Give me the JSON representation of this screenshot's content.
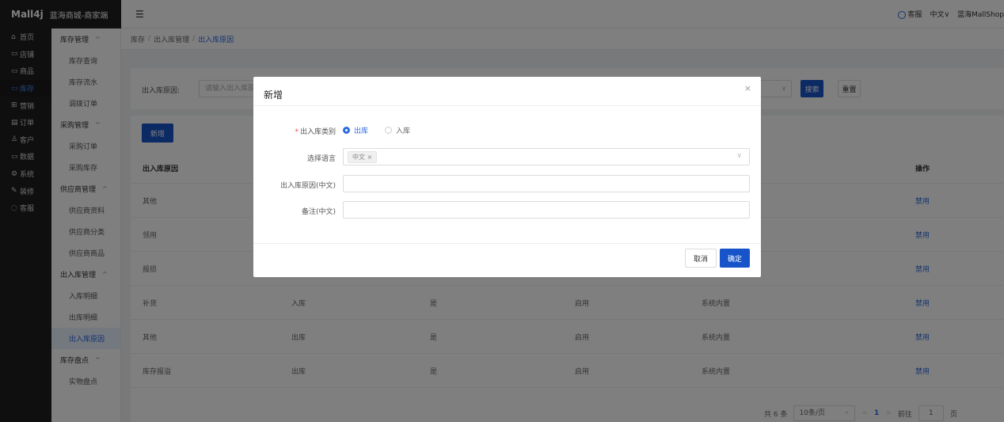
{
  "topbar": {
    "brand": "Mall4j",
    "shop_name": "蓝海商城-商家端",
    "hamburger": "☰",
    "service_label": "客服",
    "language": "中文∨",
    "user": "蓝海MallShop"
  },
  "leftnav": [
    {
      "icon": "⌂",
      "label": "首页"
    },
    {
      "icon": "▭",
      "label": "店铺"
    },
    {
      "icon": "▭",
      "label": "商品"
    },
    {
      "icon": "▭",
      "label": "库存"
    },
    {
      "icon": "⊞",
      "label": "营销"
    },
    {
      "icon": "▤",
      "label": "订单"
    },
    {
      "icon": "♙",
      "label": "客户"
    },
    {
      "icon": "▭",
      "label": "数据"
    },
    {
      "icon": "⚙",
      "label": "系统"
    },
    {
      "icon": "✎",
      "label": "装修"
    },
    {
      "icon": "◌",
      "label": "客服"
    }
  ],
  "subnav": {
    "g1": "库存管理",
    "g1a": "库存查询",
    "g1b": "库存流水",
    "g1c": "调拨订单",
    "g2": "采购管理",
    "g2a": "采购订单",
    "g2b": "采购库存",
    "g3": "供应商管理",
    "g3a": "供应商资料",
    "g3b": "供应商分类",
    "g3c": "供应商商品",
    "g4": "出入库管理",
    "g4a": "入库明细",
    "g4b": "出库明细",
    "g4c": "出入库原因",
    "g5": "库存盘点",
    "g5a": "实物盘点",
    "arrow": "^"
  },
  "breadcrumb": {
    "a": "库存",
    "b": "出入库管理",
    "c": "出入库原因",
    "sep": "/"
  },
  "search": {
    "label": "出入库原因:",
    "placeholder": "请输入出入库原因",
    "select_chev": "∨",
    "search_label": "搜索",
    "reset_label": "重置"
  },
  "table": {
    "add_label": "新增",
    "headers": [
      "出入库原因",
      "",
      "",
      "",
      "",
      "操作"
    ],
    "rows": [
      [
        "其他",
        "",
        "",
        "",
        "",
        "禁用"
      ],
      [
        "领用",
        "",
        "",
        "",
        "",
        "禁用"
      ],
      [
        "报损",
        "",
        "",
        "",
        "",
        "禁用"
      ],
      [
        "补货",
        "入库",
        "是",
        "启用",
        "系统内置",
        "禁用"
      ],
      [
        "其他",
        "出库",
        "是",
        "启用",
        "系统内置",
        "禁用"
      ],
      [
        "库存报溢",
        "出库",
        "是",
        "启用",
        "系统内置",
        "禁用"
      ]
    ]
  },
  "pager": {
    "total": "共 6 条",
    "size": "10条/页",
    "prev": "<",
    "page": "1",
    "next": ">",
    "goto": "前往",
    "goto_value": "1",
    "page_unit": "页"
  },
  "dialog": {
    "title": "新增",
    "close": "×",
    "type_label": "出入库类别",
    "required_mark": "*",
    "opt_out": "出库",
    "opt_in": "入库",
    "lang_label": "选择语言",
    "lang_tag": "中文 ×",
    "lang_chev": "∨",
    "reason_label": "出入库原因(中文)",
    "reason_value": "",
    "remark_label": "备注(中文)",
    "remark_value": "",
    "cancel_label": "取消",
    "ok_label": "确定"
  },
  "colors": {
    "primary": "#1854c9",
    "link": "#2c6be0",
    "sidebar": "#1f1f1f"
  }
}
